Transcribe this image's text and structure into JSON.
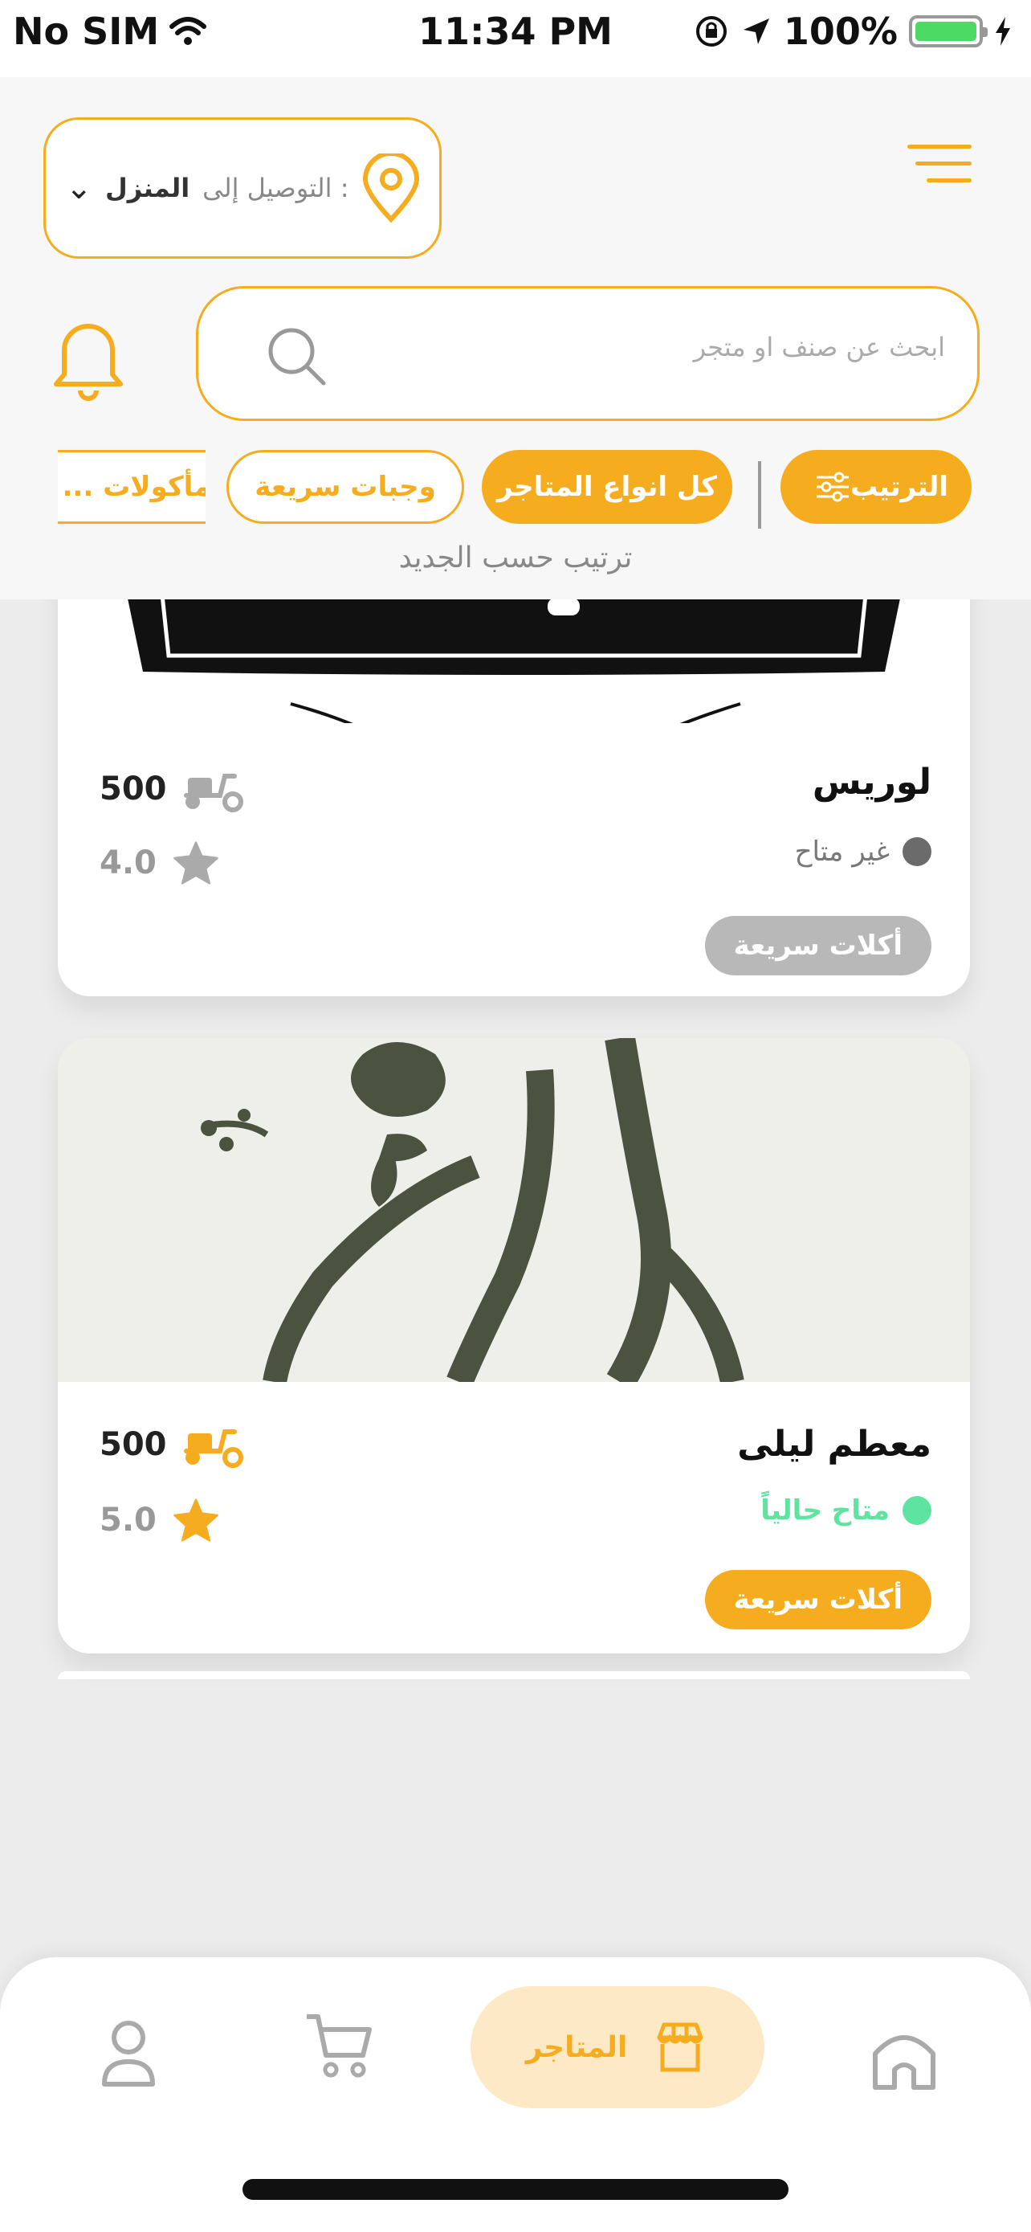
{
  "status_bar": {
    "carrier": "No SIM",
    "time": "11:34 PM",
    "battery": "100%"
  },
  "header": {
    "delivery_label": "التوصيل إلى :",
    "delivery_place": "المنزل",
    "search_placeholder": "ابحث عن صنف او متجر"
  },
  "filters": {
    "sort_label": "الترتيب",
    "chips": [
      "كل انواع المتاجر",
      "وجبات سريعة",
      "مأكولات ..."
    ],
    "sort_caption": "ترتيب حسب الجديد"
  },
  "stores": [
    {
      "name": "لوريس",
      "status": "غير متاح",
      "status_color": "#6b6b6b",
      "fee": "500",
      "rating": "4.0",
      "tag": "أكلات سريعة",
      "tag_color": "#b8b8b8",
      "available": false
    },
    {
      "name": "معطم ليلى",
      "status": "متاح حالياً",
      "status_color": "#5ee3a0",
      "fee": "500",
      "rating": "5.0",
      "tag": "أكلات سريعة",
      "tag_color": "#f5ad1f",
      "available": true
    }
  ],
  "bottom_nav": {
    "active_label": "المتاجر"
  },
  "colors": {
    "accent": "#f5ad1f",
    "accent_light": "#fde9c6",
    "unavailable": "#b8b8b8"
  }
}
